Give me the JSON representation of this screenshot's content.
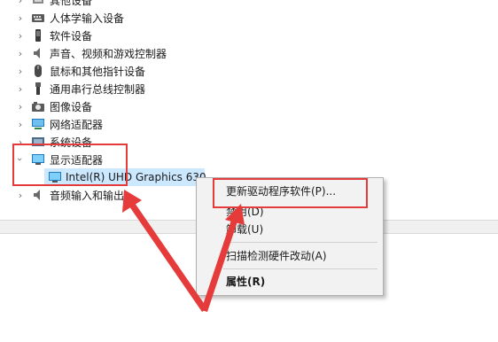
{
  "tree": {
    "items": [
      {
        "label": "其他设备",
        "icon": "other-device-icon",
        "state": "collapsed"
      },
      {
        "label": "人体学输入设备",
        "icon": "hid-keyboard-icon",
        "state": "collapsed"
      },
      {
        "label": "软件设备",
        "icon": "software-device-icon",
        "state": "collapsed"
      },
      {
        "label": "声音、视频和游戏控制器",
        "icon": "speaker-icon",
        "state": "collapsed"
      },
      {
        "label": "鼠标和其他指针设备",
        "icon": "mouse-icon",
        "state": "collapsed"
      },
      {
        "label": "通用串行总线控制器",
        "icon": "usb-icon",
        "state": "collapsed"
      },
      {
        "label": "图像设备",
        "icon": "camera-icon",
        "state": "collapsed"
      },
      {
        "label": "网络适配器",
        "icon": "network-adapter-icon",
        "state": "collapsed"
      },
      {
        "label": "系统设备",
        "icon": "system-device-icon",
        "state": "collapsed"
      },
      {
        "label": "显示适配器",
        "icon": "display-adapter-icon",
        "state": "expanded"
      },
      {
        "label": "音频输入和输出",
        "icon": "audio-icon",
        "state": "collapsed"
      }
    ],
    "child": {
      "label": "Intel(R) UHD Graphics 630",
      "icon": "display-adapter-icon",
      "selected": true
    }
  },
  "context_menu": {
    "items": [
      {
        "label": "更新驱动程序软件(P)...",
        "bold": false
      },
      {
        "label": "禁用(D)",
        "bold": false
      },
      {
        "label": "卸载(U)",
        "bold": false
      },
      {
        "label": "扫描检测硬件改动(A)",
        "bold": false
      },
      {
        "label": "属性(R)",
        "bold": true
      }
    ]
  },
  "annotation_color": "#e53b3b",
  "selection_color": "#cce8ff"
}
